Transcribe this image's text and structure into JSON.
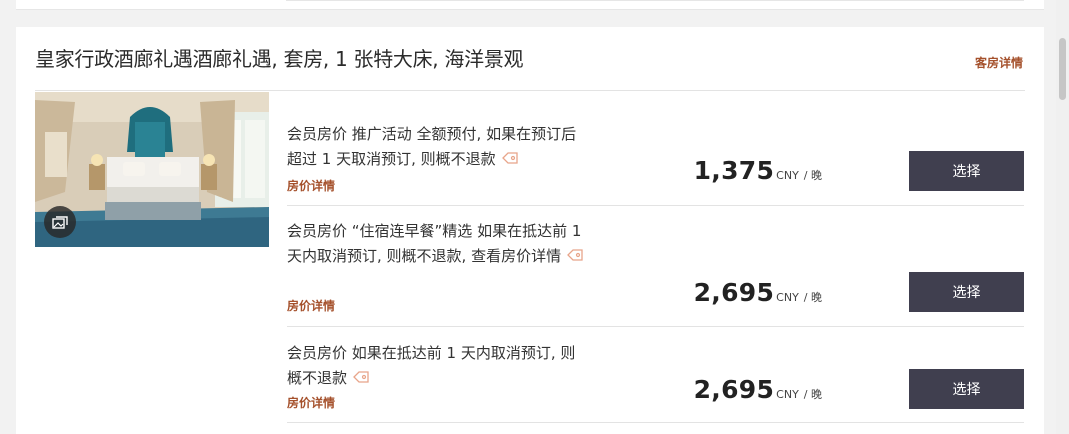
{
  "room": {
    "title": "皇家行政酒廊礼遇酒廊礼遇, 套房, 1 张特大床, 海洋景观",
    "details_link": "客房详情"
  },
  "rates": [
    {
      "description": "会员房价 推广活动 全额预付, 如果在预订后超过 1 天取消预订, 则概不退款",
      "details_link": "房价详情",
      "price": "1,375",
      "currency": "CNY",
      "per_night": "/ 晚",
      "select_label": "选择"
    },
    {
      "description": "会员房价 “住宿连早餐”精选 如果在抵达前 1 天内取消预订, 则概不退款, 查看房价详情",
      "details_link": "房价详情",
      "price": "2,695",
      "currency": "CNY",
      "per_night": "/ 晚",
      "select_label": "选择"
    },
    {
      "description": "会员房价 如果在抵达前 1 天内取消预订, 则概不退款",
      "details_link": "房价详情",
      "price": "2,695",
      "currency": "CNY",
      "per_night": "/ 晚",
      "select_label": "选择"
    }
  ],
  "colors": {
    "accent": "#a5512c",
    "button": "#403f4f",
    "tag_icon": "#e8a58a"
  }
}
